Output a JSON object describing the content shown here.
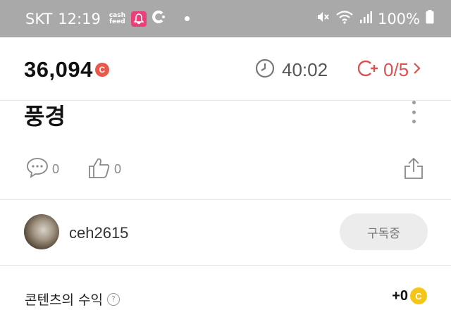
{
  "status_bar": {
    "carrier": "SKT",
    "time": "12:19",
    "cashfeed_line1": "cash",
    "cashfeed_line2": "feed",
    "battery": "100%"
  },
  "header": {
    "points": "36,094",
    "points_coin": "C",
    "timer": "40:02",
    "quota": "0/5"
  },
  "post": {
    "title": "풍경",
    "comment_count": "0",
    "like_count": "0"
  },
  "author": {
    "username": "ceh2615",
    "subscribe_label": "구독중"
  },
  "revenue": {
    "label": "콘텐츠의 수익",
    "help": "?",
    "value": "+0",
    "coin": "C"
  },
  "colors": {
    "status_bar_bg": "#a9a9a9",
    "accent_red": "#e8594c",
    "coin_yellow": "#f5c518",
    "cashfeed_pink": "#e8407b"
  }
}
